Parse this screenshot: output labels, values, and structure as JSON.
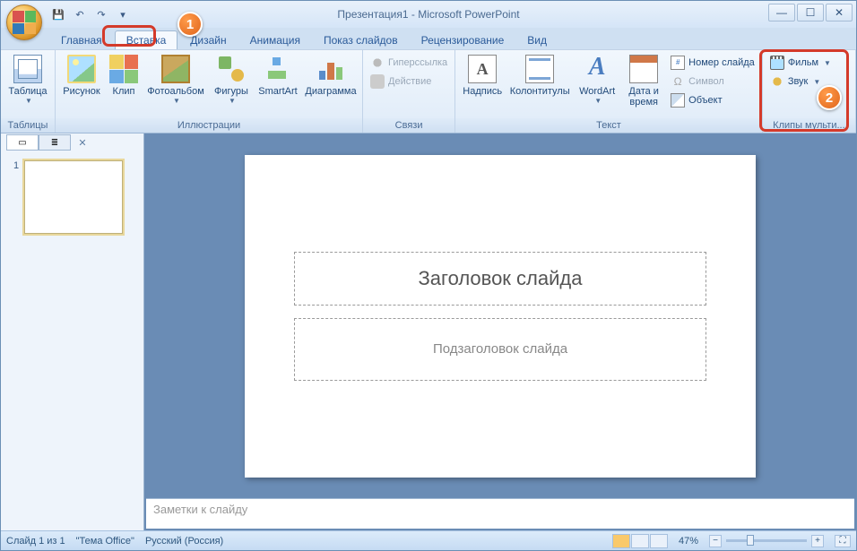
{
  "title": "Презентация1 - Microsoft PowerPoint",
  "qat": {
    "save": "💾",
    "undo": "↶",
    "redo": "↷"
  },
  "tabs": [
    {
      "label": "Главная"
    },
    {
      "label": "Вставка"
    },
    {
      "label": "Дизайн"
    },
    {
      "label": "Анимация"
    },
    {
      "label": "Показ слайдов"
    },
    {
      "label": "Рецензирование"
    },
    {
      "label": "Вид"
    }
  ],
  "groups": {
    "tables": {
      "label": "Таблицы",
      "table": "Таблица"
    },
    "illustrations": {
      "label": "Иллюстрации",
      "picture": "Рисунок",
      "clip": "Клип",
      "album": "Фотоальбом",
      "shapes": "Фигуры",
      "smartart": "SmartArt",
      "chart": "Диаграмма"
    },
    "links": {
      "label": "Связи",
      "hyperlink": "Гиперссылка",
      "action": "Действие"
    },
    "text": {
      "label": "Текст",
      "textbox": "Надпись",
      "headerfooter": "Колонтитулы",
      "wordart": "WordArt",
      "datetime": "Дата и время",
      "slidenum": "Номер слайда",
      "symbol": "Символ",
      "object": "Объект"
    },
    "media": {
      "label": "Клипы мульти...",
      "movie": "Фильм",
      "sound": "Звук"
    }
  },
  "slide": {
    "title_placeholder": "Заголовок слайда",
    "subtitle_placeholder": "Подзаголовок слайда"
  },
  "notes": {
    "placeholder": "Заметки к слайду"
  },
  "status": {
    "slide_info": "Слайд 1 из 1",
    "theme": "\"Тема Office\"",
    "lang": "Русский (Россия)",
    "zoom": "47%"
  },
  "thumb": {
    "num": "1"
  },
  "callouts": {
    "one": "1",
    "two": "2"
  }
}
